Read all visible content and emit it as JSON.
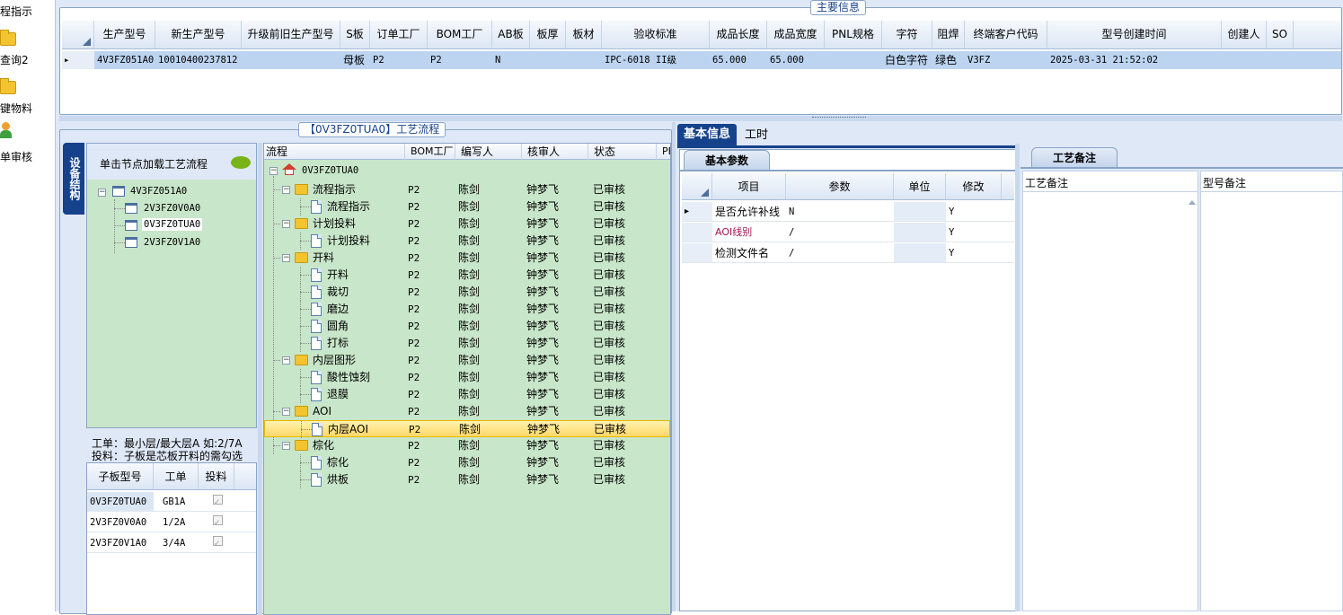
{
  "left_nav": [
    {
      "label": "程指示"
    },
    {
      "label": "查询2"
    },
    {
      "label": "键物料"
    },
    {
      "label": "单审核"
    }
  ],
  "main_info": {
    "title": "主要信息",
    "columns": [
      "生产型号",
      "新生产型号",
      "升级前旧生产型号",
      "S板",
      "订单工厂",
      "BOM工厂",
      "AB板",
      "板厚",
      "板材",
      "验收标准",
      "成品长度",
      "成品宽度",
      "PNL规格",
      "字符",
      "阻焊",
      "终端客户代码",
      "型号创建时间",
      "创建人",
      "SO"
    ],
    "row": {
      "prod_model": "4V3FZ051A0",
      "new_model": "10010400237812",
      "old_model": "",
      "s_board": "母板",
      "order_factory": "P2",
      "bom_factory": "P2",
      "ab_board": "N",
      "thickness": "",
      "material": "",
      "acceptance": "IPC-6018 II级",
      "length": "65.000",
      "width": "65.000",
      "pnl": "",
      "char": "白色字符",
      "solder": "绿色",
      "customer_code": "V3FZ",
      "created": "2025-03-31 21:52:02",
      "creator": "",
      "so": ""
    }
  },
  "process": {
    "title": "【0V3FZ0TUA0】工艺流程",
    "vertical_tab": "设备结构",
    "hint": "单击节点加载工艺流程",
    "tree": {
      "root": "4V3FZ051A0",
      "children": [
        "2V3FZ0V0A0",
        "0V3FZ0TUA0",
        "2V3FZ0V1A0"
      ]
    },
    "note_line1": "工单：最小层/最大层A 如:2/7A",
    "note_line2": "投料：子板是芯板开料的需勾选",
    "sub_table": {
      "headers": [
        "子板型号",
        "工单",
        "投料"
      ],
      "rows": [
        {
          "model": "0V3FZ0TUA0",
          "order": "GB1A"
        },
        {
          "model": "2V3FZ0V0A0",
          "order": "1/2A"
        },
        {
          "model": "2V3FZ0V1A0",
          "order": "3/4A"
        }
      ]
    },
    "flow_headers": [
      "流程",
      "BOM工厂",
      "编写人",
      "核审人",
      "状态",
      "PE"
    ],
    "flow_root": "0V3FZ0TUA0",
    "flow_rows": [
      {
        "name": "流程指示",
        "bom": "P2",
        "writer": "陈剑",
        "reviewer": "钟梦飞",
        "status": "已审核"
      },
      {
        "name": "流程指示",
        "bom": "P2",
        "writer": "陈剑",
        "reviewer": "钟梦飞",
        "status": "已审核"
      },
      {
        "name": "计划投料",
        "bom": "P2",
        "writer": "陈剑",
        "reviewer": "钟梦飞",
        "status": "已审核"
      },
      {
        "name": "计划投料",
        "bom": "P2",
        "writer": "陈剑",
        "reviewer": "钟梦飞",
        "status": "已审核"
      },
      {
        "name": "开料",
        "bom": "P2",
        "writer": "陈剑",
        "reviewer": "钟梦飞",
        "status": "已审核"
      },
      {
        "name": "开料",
        "bom": "P2",
        "writer": "陈剑",
        "reviewer": "钟梦飞",
        "status": "已审核"
      },
      {
        "name": "裁切",
        "bom": "P2",
        "writer": "陈剑",
        "reviewer": "钟梦飞",
        "status": "已审核"
      },
      {
        "name": "磨边",
        "bom": "P2",
        "writer": "陈剑",
        "reviewer": "钟梦飞",
        "status": "已审核"
      },
      {
        "name": "圆角",
        "bom": "P2",
        "writer": "陈剑",
        "reviewer": "钟梦飞",
        "status": "已审核"
      },
      {
        "name": "打标",
        "bom": "P2",
        "writer": "陈剑",
        "reviewer": "钟梦飞",
        "status": "已审核"
      },
      {
        "name": "内层图形",
        "bom": "P2",
        "writer": "陈剑",
        "reviewer": "钟梦飞",
        "status": "已审核"
      },
      {
        "name": "酸性蚀刻",
        "bom": "P2",
        "writer": "陈剑",
        "reviewer": "钟梦飞",
        "status": "已审核"
      },
      {
        "name": "退膜",
        "bom": "P2",
        "writer": "陈剑",
        "reviewer": "钟梦飞",
        "status": "已审核"
      },
      {
        "name": "AOI",
        "bom": "P2",
        "writer": "陈剑",
        "reviewer": "钟梦飞",
        "status": "已审核"
      },
      {
        "name": "内层AOI",
        "bom": "P2",
        "writer": "陈剑",
        "reviewer": "钟梦飞",
        "status": "已审核"
      },
      {
        "name": "棕化",
        "bom": "P2",
        "writer": "陈剑",
        "reviewer": "钟梦飞",
        "status": "已审核"
      },
      {
        "name": "棕化",
        "bom": "P2",
        "writer": "陈剑",
        "reviewer": "钟梦飞",
        "status": "已审核"
      },
      {
        "name": "烘板",
        "bom": "P2",
        "writer": "陈剑",
        "reviewer": "钟梦飞",
        "status": "已审核"
      }
    ]
  },
  "basic_info": {
    "tabs": [
      "基本信息",
      "工时"
    ],
    "sub_tab": "基本参数",
    "headers": [
      "项目",
      "参数",
      "单位",
      "修改"
    ],
    "rows": [
      {
        "item": "是否允许补线",
        "param": "N",
        "unit": "",
        "modify": "Y"
      },
      {
        "item": "AOI线别",
        "param": "/",
        "unit": "",
        "modify": "Y"
      },
      {
        "item": "检测文件名",
        "param": "/",
        "unit": "",
        "modify": "Y"
      }
    ]
  },
  "remarks": {
    "tab": "工艺备注",
    "col1": "工艺备注",
    "col2": "型号备注"
  },
  "colors": {
    "accent": "#15428b",
    "frame": "#dfe8f6",
    "green_panel": "#c8e6c9",
    "selected_row": "#bcd4f0",
    "highlight": "#ffd866"
  }
}
